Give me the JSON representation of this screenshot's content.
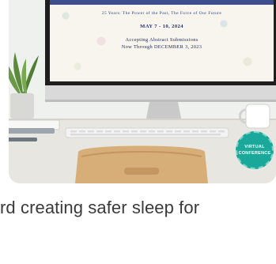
{
  "promo": {
    "tagline": "25 Years: The Power of the Past, The Force of Our Future",
    "dates": "MAY 7 - 10, 2024",
    "line1": "Accepting Abstract Submissions",
    "line2": "Now Through DECEMBER 3, 2023"
  },
  "badge": {
    "line1": "VIRTUAL",
    "line2": "CONFERENCE"
  },
  "article": {
    "headline_fragment": "rd creating safer sleep for"
  },
  "colors": {
    "accent_navy": "#22347a",
    "badge_teal": "#1aa89a",
    "text": "#3a3a3a"
  },
  "icons": [
    "virtual-conference-badge"
  ]
}
